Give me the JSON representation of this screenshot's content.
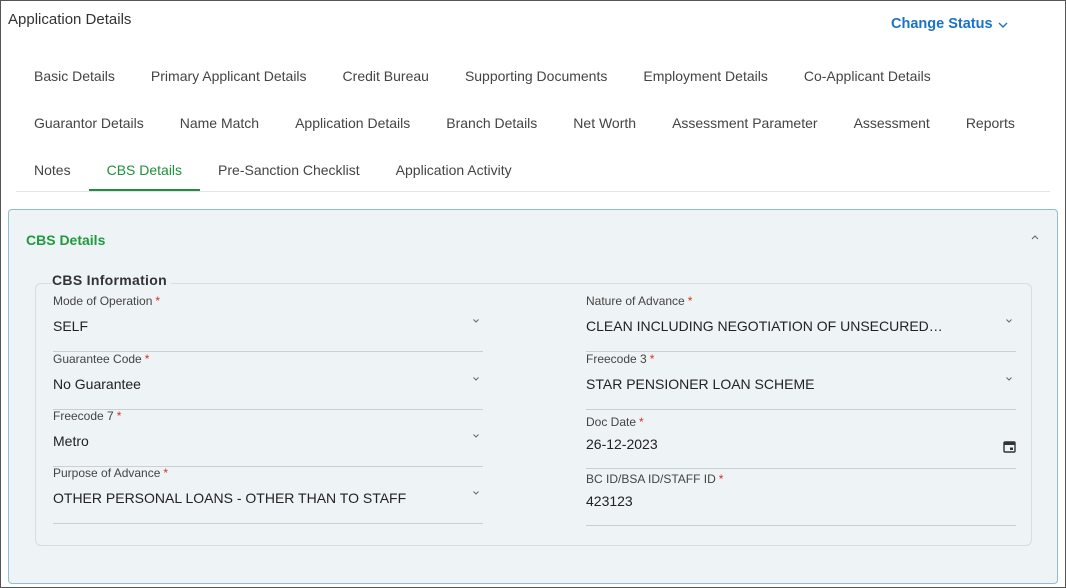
{
  "header": {
    "title": "Application Details",
    "change_status_label": "Change Status"
  },
  "tabs": {
    "row1": [
      "Basic Details",
      "Primary Applicant Details",
      "Credit Bureau",
      "Supporting Documents",
      "Employment Details",
      "Co-Applicant Details"
    ],
    "row2": [
      "Guarantor Details",
      "Name Match",
      "Application Details",
      "Branch Details",
      "Net Worth",
      "Assessment Parameter",
      "Assessment",
      "Reports"
    ],
    "row3": [
      "Notes",
      "CBS Details",
      "Pre-Sanction Checklist",
      "Application Activity"
    ],
    "active": "CBS Details"
  },
  "panel": {
    "title": "CBS Details",
    "section_title": "CBS Information",
    "fields": {
      "mode_of_operation": {
        "label": "Mode of Operation",
        "value": "SELF",
        "required_mark": "*"
      },
      "nature_of_advance": {
        "label": "Nature of Advance",
        "value": "CLEAN INCLUDING NEGOTIATION OF UNSECURED…",
        "required_mark": "*"
      },
      "guarantee_code": {
        "label": "Guarantee Code",
        "value": "No Guarantee",
        "required_mark": "*"
      },
      "freecode_3": {
        "label": "Freecode 3",
        "value": "STAR PENSIONER LOAN SCHEME",
        "required_mark": "*"
      },
      "freecode_7": {
        "label": "Freecode 7",
        "value": "Metro",
        "required_mark": "*"
      },
      "doc_date": {
        "label": "Doc Date",
        "value": "26-12-2023",
        "required_mark": "*"
      },
      "purpose_of_advance": {
        "label": "Purpose of Advance",
        "value": "OTHER PERSONAL LOANS - OTHER THAN TO STAFF",
        "required_mark": "*"
      },
      "bc_id": {
        "label": "BC ID/BSA ID/STAFF ID",
        "value": "423123",
        "required_mark": "*"
      }
    }
  },
  "colors": {
    "accent_green": "#1f8f3a",
    "link_blue": "#1a73c8",
    "required_red": "#d93025",
    "panel_bg": "#eef3f5"
  },
  "icons": [
    "chevron-down-icon",
    "chevron-up-icon",
    "calendar-icon"
  ]
}
